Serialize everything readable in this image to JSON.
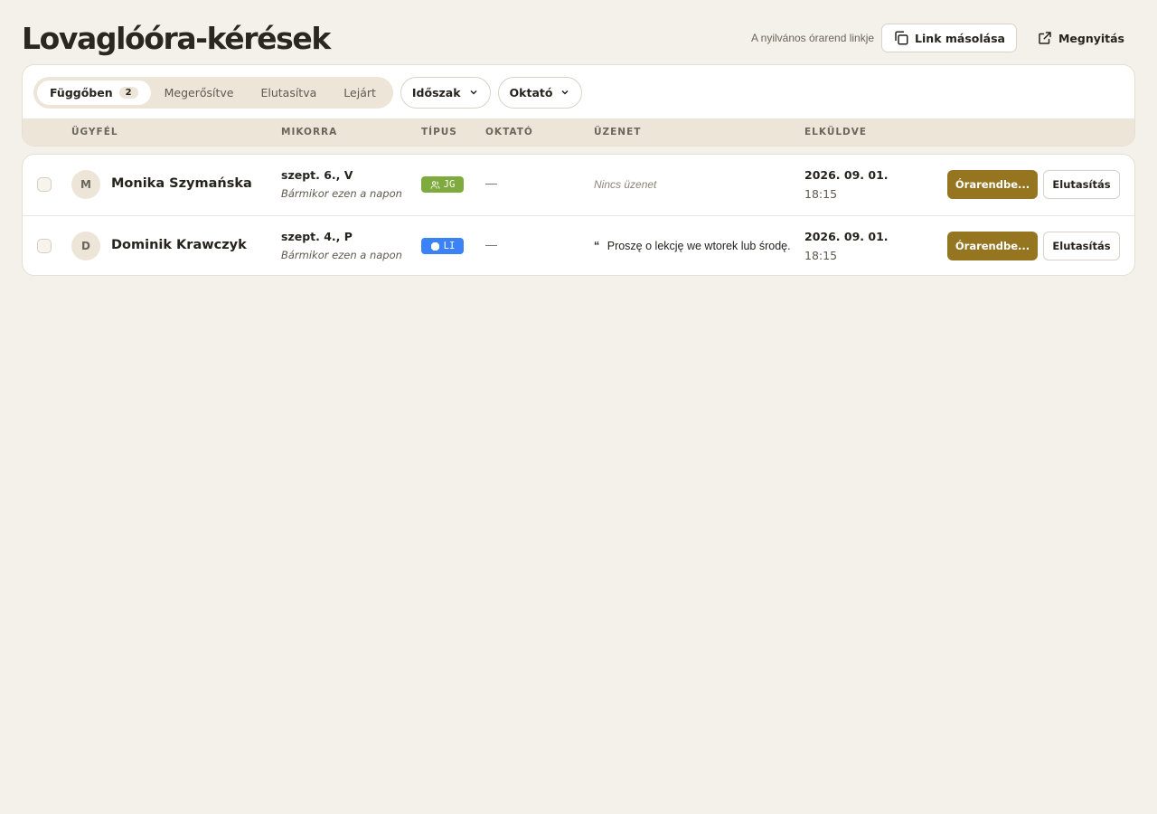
{
  "page": {
    "title": "Lovaglóóra-kérések"
  },
  "header": {
    "public_link_label": "A nyilvános órarend linkje",
    "copy_link_label": "Link másolása",
    "copy_link_icon": "copy-icon",
    "open_label": "Megnyitás",
    "open_icon": "external-link-icon"
  },
  "filters": {
    "status_tabs": [
      {
        "label": "Függőben",
        "count": "2",
        "active": true
      },
      {
        "label": "Megerősítve"
      },
      {
        "label": "Elutasítva"
      },
      {
        "label": "Lejárt"
      }
    ],
    "period_label": "Időszak",
    "instructor_label": "Oktató",
    "dropdown_icon": "chevron-down-icon"
  },
  "table": {
    "columns": [
      "ÜGYFÉL",
      "MIKORRA",
      "TÍPUS",
      "OKTATÓ",
      "ÜZENET",
      "ELKÜLDVE"
    ],
    "rows": [
      {
        "initial": "M",
        "client": "Monika Szymańska",
        "day": "szept. 6., V",
        "time_note": "Bármikor ezen a napon",
        "type_code": "JG",
        "type_icon": "group-icon",
        "type_color": "#7fab3e",
        "instructor": "—",
        "message": "Nincs üzenet",
        "sent_date": "2026. 09. 01.",
        "sent_time": "18:15",
        "schedule_label": "Órarendbe...",
        "reject_label": "Elutasítás"
      },
      {
        "initial": "D",
        "client": "Dominik Krawczyk",
        "day": "szept. 4., P",
        "time_note": "Bármikor ezen a napon",
        "type_code": "LI",
        "type_icon": "single-icon",
        "type_color": "#3b82f6",
        "instructor": "—",
        "quote_mark": "“",
        "message": "Proszę o lekcję we wtorek lub środę.",
        "sent_date": "2026. 09. 01.",
        "sent_time": "18:15",
        "schedule_label": "Órarendbe...",
        "reject_label": "Elutasítás"
      }
    ]
  },
  "colors": {
    "background": "#f4f1ea",
    "accent": "#957520",
    "header_band": "#ede5d8"
  }
}
